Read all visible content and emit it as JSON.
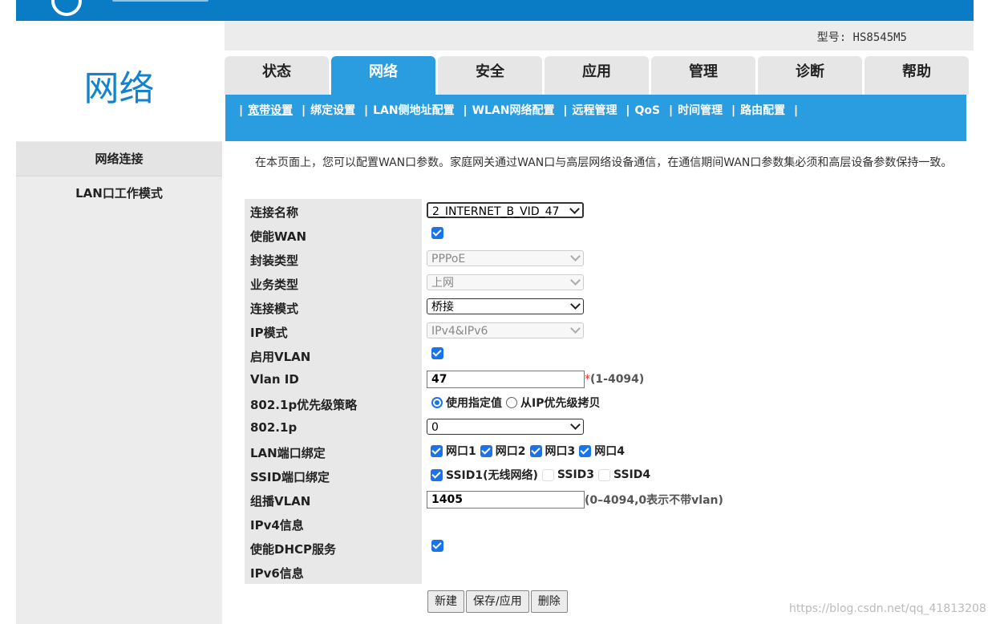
{
  "model_label": "型号: HS8545M5",
  "side": {
    "title": "网络",
    "items": [
      "网络连接",
      "LAN口工作模式"
    ]
  },
  "tabs": [
    "状态",
    "网络",
    "安全",
    "应用",
    "管理",
    "诊断",
    "帮助"
  ],
  "subnav": [
    "宽带设置",
    "绑定设置",
    "LAN侧地址配置",
    "WLAN网络配置",
    "远程管理",
    "QoS",
    "时间管理",
    "路由配置"
  ],
  "intro": "在本页面上，您可以配置WAN口参数。家庭网关通过WAN口与高层网络设备通信，在通信期间WAN口参数集必须和高层设备参数保持一致。",
  "form": {
    "conn_name": {
      "label": "连接名称",
      "value": "2_INTERNET_B_VID_47"
    },
    "enable_wan": {
      "label": "使能WAN"
    },
    "encap": {
      "label": "封装类型",
      "value": "PPPoE"
    },
    "service": {
      "label": "业务类型",
      "value": "上网"
    },
    "conn_mode": {
      "label": "连接模式",
      "value": "桥接"
    },
    "ip_mode": {
      "label": "IP模式",
      "value": "IPv4&IPv6"
    },
    "enable_vlan": {
      "label": "启用VLAN"
    },
    "vlan_id": {
      "label": "Vlan ID",
      "value": "47",
      "required": "*",
      "hint": "(1-4094)"
    },
    "prio_policy": {
      "label": "802.1p优先级策略",
      "opt1": "使用指定值",
      "opt2": "从IP优先级拷贝"
    },
    "prio": {
      "label": "802.1p",
      "value": "0"
    },
    "lan_bind": {
      "label": "LAN端口绑定",
      "ports": [
        "网口1",
        "网口2",
        "网口3",
        "网口4"
      ]
    },
    "ssid_bind": {
      "label": "SSID端口绑定",
      "ssids": [
        "SSID1(无线网络)",
        "SSID3",
        "SSID4"
      ]
    },
    "mcast_vlan": {
      "label": "组播VLAN",
      "value": "1405",
      "hint": "(0–4094,0表示不带vlan)"
    },
    "ipv4_info": {
      "label": "IPv4信息"
    },
    "dhcp": {
      "label": "使能DHCP服务"
    },
    "ipv6_info": {
      "label": "IPv6信息"
    }
  },
  "buttons": {
    "new": "新建",
    "save": "保存/应用",
    "delete": "删除"
  },
  "watermark": "https://blog.csdn.net/qq_41813208"
}
